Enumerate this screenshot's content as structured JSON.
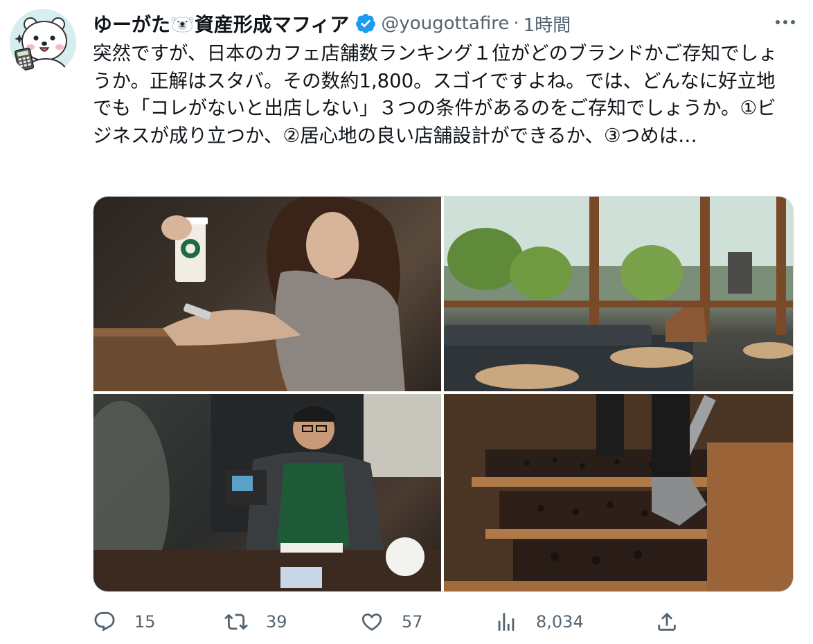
{
  "author": {
    "display_name": "ゆーがた🐻‍❄️資産形成マフィア",
    "handle": "@yougottafire",
    "separator": "·",
    "time": "1時間",
    "verified": true
  },
  "tweet": {
    "text": "突然ですが、日本のカフェ店舗数ランキング１位がどのブランドかご存知でしょうか。正解はスタバ。その数約1,800。スゴイですよね。では、どんなに好立地でも「コレがないと出店しない」３つの条件があるのをご存知でしょうか。①ビジネスが成り立つか、②居心地の良い店舗設計ができるか、③つめは…"
  },
  "media": {
    "photos": [
      {
        "icon": "photo-woman-with-starbucks-cup"
      },
      {
        "icon": "photo-cafe-interior-with-plants"
      },
      {
        "icon": "photo-barista-at-counter"
      },
      {
        "icon": "photo-coffee-bean-bins"
      }
    ]
  },
  "actions": {
    "reply": {
      "icon": "reply-icon",
      "count": "15"
    },
    "retweet": {
      "icon": "retweet-icon",
      "count": "39"
    },
    "like": {
      "icon": "heart-icon",
      "count": "57"
    },
    "views": {
      "icon": "analytics-icon",
      "count": "8,034"
    },
    "share": {
      "icon": "share-icon"
    }
  },
  "colors": {
    "text_primary": "#0f1419",
    "text_secondary": "#536471",
    "verified_blue": "#1d9bf0",
    "border": "#cfd9de"
  }
}
